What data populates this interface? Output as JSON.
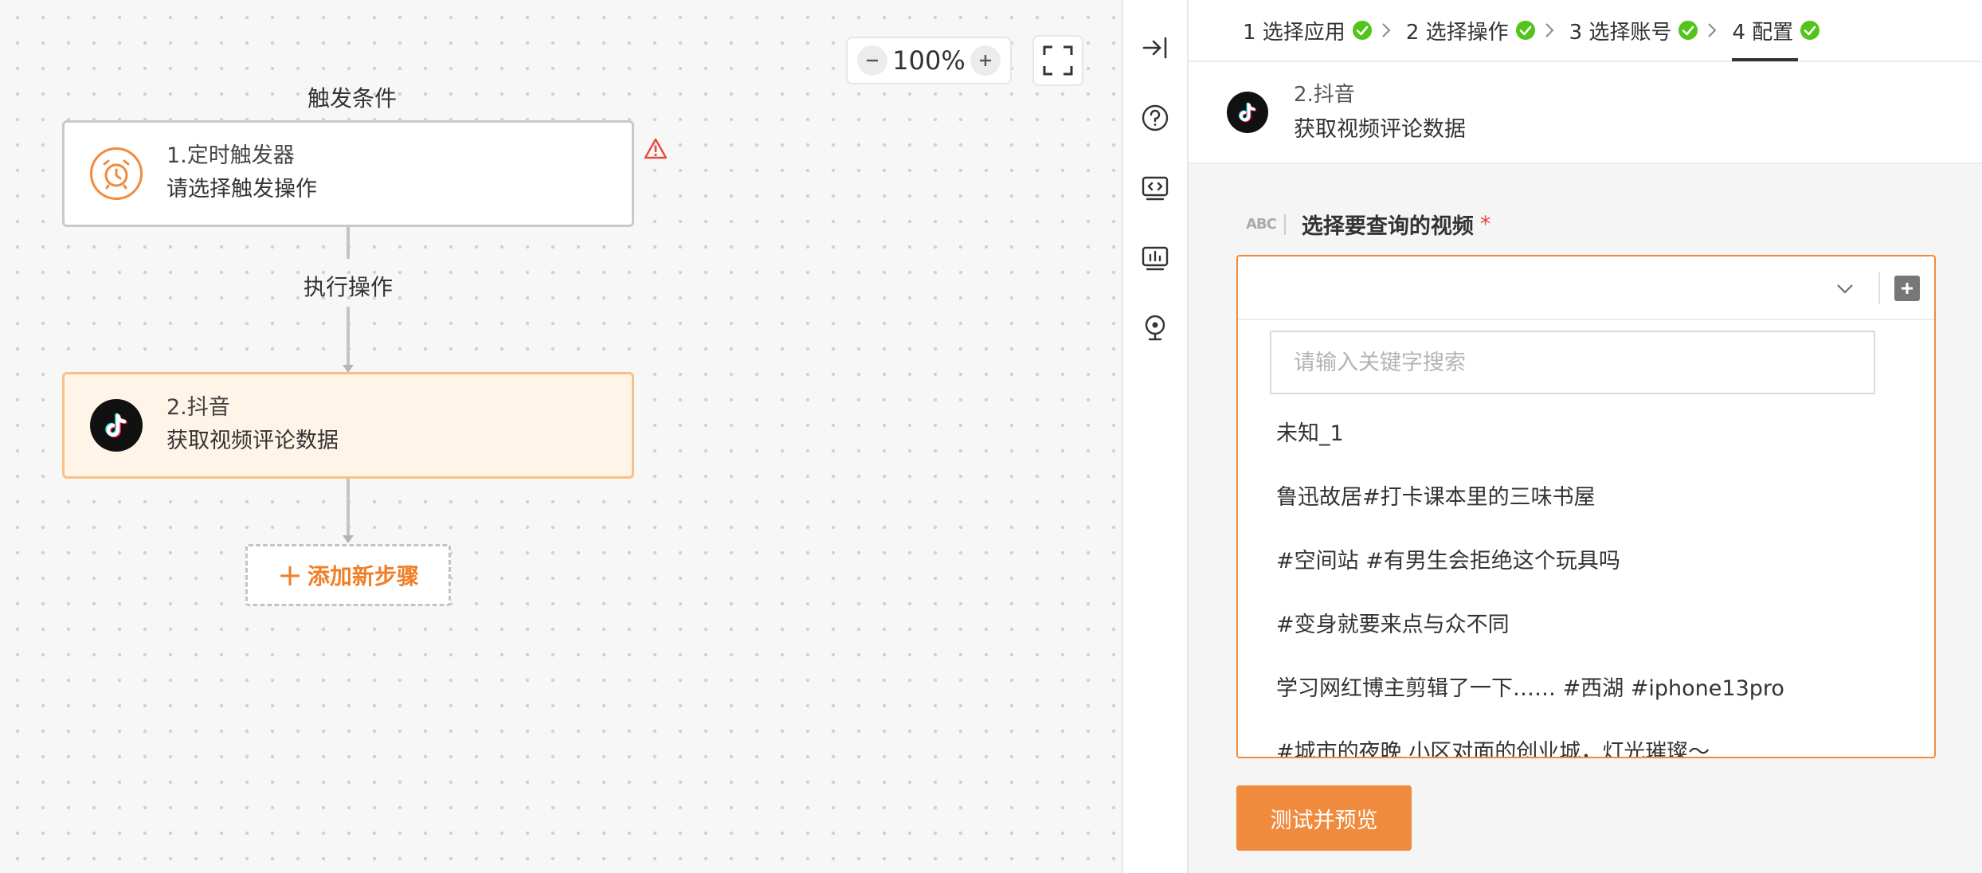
{
  "canvas": {
    "zoom": "100%",
    "zoom_out_icon": "minus-icon",
    "zoom_in_icon": "plus-icon",
    "fullscreen_icon": "fullscreen-icon",
    "trigger_section_label": "触发条件",
    "action_section_label": "执行操作",
    "trigger_node": {
      "title": "1.定时触发器",
      "subtitle": "请选择触发操作",
      "icon": "alarm-clock-icon",
      "warning_icon": "warning-icon"
    },
    "action_node": {
      "title": "2.抖音",
      "subtitle": "获取视频评论数据",
      "icon": "tiktok-icon"
    },
    "add_step": {
      "label": "添加新步骤",
      "icon": "plus-icon"
    }
  },
  "toolbar": {
    "icons": [
      "collapse-panel-icon",
      "help-icon",
      "code-icon",
      "chart-icon",
      "location-pin-icon"
    ]
  },
  "steps": [
    {
      "label": "1 选择应用",
      "done": true
    },
    {
      "label": "2 选择操作",
      "done": true
    },
    {
      "label": "3 选择账号",
      "done": true
    },
    {
      "label": "4 配置",
      "done": true,
      "active": true
    }
  ],
  "app": {
    "title": "2.抖音",
    "subtitle": "获取视频评论数据",
    "icon": "tiktok-icon"
  },
  "field": {
    "type_badge": "ABC",
    "label": "选择要查询的视频",
    "required_mark": "*",
    "value": "",
    "search_placeholder": "请输入关键字搜索",
    "options": [
      "未知_1",
      "鲁迅故居#打卡课本里的三味书屋",
      "#空间站 #有男生会拒绝这个玩具吗",
      "#变身就要来点与众不同",
      "学习网红博主剪辑了一下…… #西湖 #iphone13pro",
      "#城市的夜晚 小区对面的创业城，灯光璀璨～"
    ]
  },
  "test_button": {
    "label": "测试并预览"
  },
  "colors": {
    "accent": "#f08a3c",
    "success": "#52c41a",
    "warning": "#e64b3c",
    "canvas_bg": "#f7f7f7"
  }
}
